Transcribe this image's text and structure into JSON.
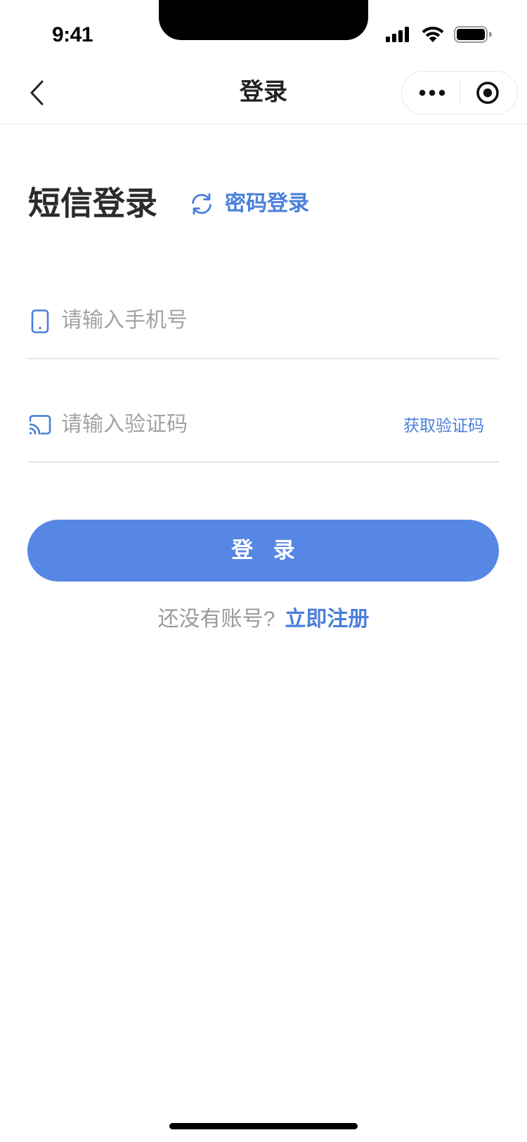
{
  "status_bar": {
    "time": "9:41",
    "signal_icon": "cellular-signal-icon",
    "wifi_icon": "wifi-icon",
    "battery_icon": "battery-icon"
  },
  "nav_bar": {
    "title": "登录",
    "back_icon": "chevron-left-icon",
    "more_icon": "more-dots-icon",
    "close_icon": "target-circle-icon"
  },
  "login_form": {
    "heading": "短信登录",
    "switch_mode": {
      "icon": "refresh-icon",
      "label": "密码登录"
    },
    "phone_field": {
      "icon": "phone-icon",
      "placeholder": "请输入手机号",
      "value": ""
    },
    "code_field": {
      "icon": "cast-icon",
      "placeholder": "请输入验证码",
      "value": "",
      "get_code_label": "获取验证码"
    },
    "submit_label": "登 录",
    "register": {
      "prompt": "还没有账号?",
      "link_label": "立即注册"
    }
  },
  "colors": {
    "accent": "#4A7FDB",
    "button_bg": "#5787E5",
    "button_text": "#FFFFFF",
    "heading_text": "#2B2B2B",
    "placeholder_text": "#A3A3A3",
    "divider": "#E6E6E6"
  }
}
